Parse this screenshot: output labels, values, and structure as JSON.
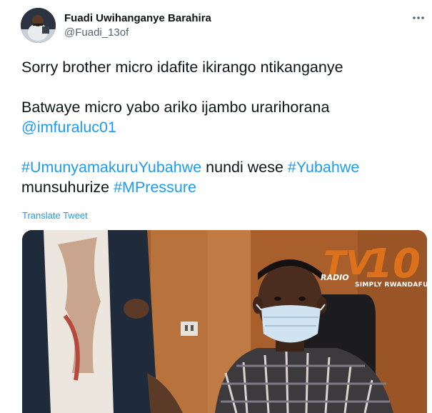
{
  "author": {
    "display_name": "Fuadi Uwihanganye Barahira",
    "handle": "@Fuadi_13of",
    "avatar_icon": "profile-avatar"
  },
  "more_icon": "more-dots-icon",
  "tweet": {
    "line1": "Sorry brother micro idafite ikirango ntikanganye",
    "line2": "Batwaye micro yabo ariko ijambo urarihorana",
    "mention": "@imfuraluc01",
    "hashtag1": "#UmunyamakuruYubahwe",
    "mid_text": " nundi wese ",
    "hashtag2": "#Yubahwe",
    "line4_prefix": "munsuhurize ",
    "hashtag3": "#MPressure"
  },
  "translate_label": "Translate Tweet",
  "media": {
    "watermark_radio": "RADIO",
    "watermark_tagline": "SIMPLY RWANDAFUL",
    "watermark_brand": "TV10"
  },
  "colors": {
    "link": "#1d9bf0",
    "text": "#0f1419",
    "secondary": "#536471",
    "watermark": "#e8761a"
  }
}
